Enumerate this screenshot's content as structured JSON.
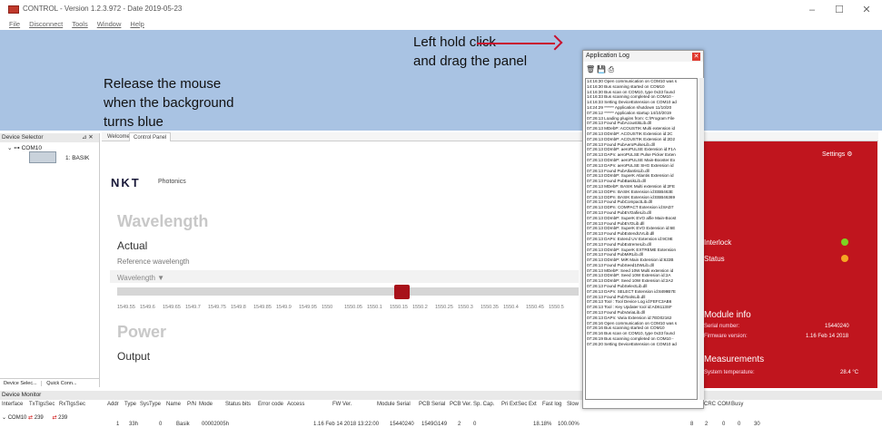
{
  "window": {
    "title": "CONTROL - Version 1.2.3.972 - Date 2019-05-23"
  },
  "menu": [
    "File",
    "Disconnect",
    "Tools",
    "Window",
    "Help"
  ],
  "annotations": {
    "release_lines": [
      "Release the mouse",
      "when the background",
      "turns blue"
    ],
    "drag_lines": [
      "Left hold click",
      "and drag the panel"
    ]
  },
  "device_selector": {
    "title": "Device Selector",
    "port": "COM10",
    "device": "1: BASIK",
    "tabs": [
      "Device Selec...",
      "Quick Conn..."
    ]
  },
  "main_tabs": [
    "Welcome",
    "Control Panel"
  ],
  "control_panel": {
    "brand": "NKT",
    "brand_sub": "Photonics",
    "wavelength_heading": "Wavelength",
    "actual_label": "Actual",
    "reference_label": "Reference wavelength",
    "wavelength_dropdown": "Wavelength ▼",
    "ticks": [
      "1549.55",
      "1549.6",
      "1549.65",
      "1549.7",
      "1549.75",
      "1549.8",
      "1549.85",
      "1549.9",
      "1549.95",
      "1550",
      "1550.05",
      "1550.1",
      "1550.15",
      "1550.2",
      "1550.25",
      "1550.3",
      "1550.35",
      "1550.4",
      "1550.45",
      "1550.5"
    ],
    "power_heading": "Power",
    "output_label": "Output"
  },
  "right_panel": {
    "settings_label": "Settings",
    "interlock_label": "Interlock",
    "status_label": "Status",
    "interlock_color": "#7ed321",
    "status_color": "#f5a623",
    "module_info_title": "Module info",
    "serial_label": "Serial number:",
    "serial_value": "15440240",
    "firmware_label": "Firmware version:",
    "firmware_value": "1.16 Feb 14 2018",
    "measurements_title": "Measurements",
    "temp_label": "System temperature:",
    "temp_value": "28.4 °C"
  },
  "app_log": {
    "title": "Application Log",
    "lines": [
      "14:16:30 Open communication on COM10 was s",
      "14:16:30 Bus scanning started on COM10",
      "14:16:30 Bus scan on COM10, type 0x33 found",
      "14:16:33 Bus scanning completed on COM10 -",
      "14:16:33 Setting DeviceExtension on COM10 ad",
      "14:24:29 ****** Application shutdown 11/10/20",
      "07:26:12 ****** Application startup 14/10/2019",
      "07:26:13 Loading plugins from: C:\\Program File",
      "07:26:13 Found PubAcoustikLib.dll",
      "07:26:13   MDebP: ACOUSTIK Multi extension id",
      "07:26:13     DDmbP: ACOUSTIK Extension id:2C",
      "07:26:13   DDmbP: ACOUSTIK Extension id:2D2",
      "07:26:13 Found PubAeroPulseLib.dll",
      "07:26:13   DDmbP: aeroPULSE Extension id:F1A",
      "07:26:13     DAPn: aeroPULSE Pulse Picker Exten",
      "07:26:13   DDmbP: aeroPULSE Main-Booster Ex",
      "07:26:13     DAPn: aeroPULSE SHG Extension id",
      "07:26:13 Found PubAtlantisLib.dll",
      "07:26:13   DDmbP: SuperK Atlantis Extension id",
      "07:26:13 Found PubBasikLib.dll",
      "07:26:13   MDebP: BASIK Multi extension id:2FE",
      "07:26:13     DDPn: BASIK Extension id:EBB463E",
      "07:26:13   DDPn: BASIK Extension id:EBB46369",
      "07:26:13 Found PubCompactLib.dll",
      "07:26:13     DDPn: COMPACT Extension id:8AD7",
      "07:26:13 Found PubEVOafieLib.dll",
      "07:26:13   DDmbP: SuperK EVO alfie Main-Boost",
      "07:26:13 Found PubEVOLib.dll",
      "07:26:13   DDmbP: SuperK EVO Extension id:6E",
      "07:26:13 Found PubExtendUVLib.dll",
      "07:26:13     DAPn: Extend UV Extension id:9C9E",
      "07:26:13 Found PubExtremeLib.dll",
      "07:26:13   DDmbP: SuperK EXTREME Extension",
      "07:26:13 Found PubMiRLib.dll",
      "07:26:13   DDmbP: MiR Main Extension id:622B",
      "07:26:13 Found PubSeed10WLib.dll",
      "07:26:13   MDebP: Seed 10W Multi extension id",
      "07:26:13     DDmbP: Seed 10W Extension id:2A",
      "07:26:13   DDmbP: Seed 10W Extension id:2A2",
      "07:26:13 Found PubSelectLib.dll",
      "07:26:13     DAPn: SELECT Extension id:8499B7E",
      "07:26:13 Found PubToolsLib.dll",
      "07:26:13   Tool : Tool Device Log id:FEFC3AB6",
      "07:26:13   Tool : Key Updater tool id:AD6113SF",
      "07:26:13 Found PubVariaLib.dll",
      "07:26:13   DAPn: Varia Extension id:7ED02162",
      "07:26:16 Open communication on COM10 was s",
      "07:26:16 Bus scanning started on COM10",
      "07:26:16 Bus scan on COM10, type 0x33 found",
      "07:26:19 Bus scanning completed on COM10 -",
      "07:26:20 Setting DeviceExtension on COM10 ad"
    ]
  },
  "device_monitor": {
    "title": "Device Monitor",
    "columns": [
      "Interface",
      "TxTlgsSec",
      "RxTlgsSec",
      "Addr",
      "Type",
      "SysType",
      "Name",
      "P/N",
      "Mode",
      "Status bits",
      "Error code",
      "Access",
      "FW Ver.",
      "Module Serial",
      "PCB Serial",
      "PCB Ver.",
      "Sp. Cap.",
      "Pri Ext",
      "Sec Ext",
      "Fast log",
      "Slow",
      "ick",
      "CRC",
      "COM",
      "Busy"
    ],
    "iface": "COM10",
    "tx": "239",
    "rx": "239",
    "row": [
      "1",
      "33h",
      "0",
      "Basik",
      "",
      "00002005h",
      "",
      "",
      "1.16 Feb 14 2018 13:22:00",
      "15440240",
      "1549G149",
      "2",
      "0",
      "",
      "",
      "18.18%",
      "100.00%",
      "8",
      "2",
      "0",
      "0",
      "30"
    ]
  }
}
